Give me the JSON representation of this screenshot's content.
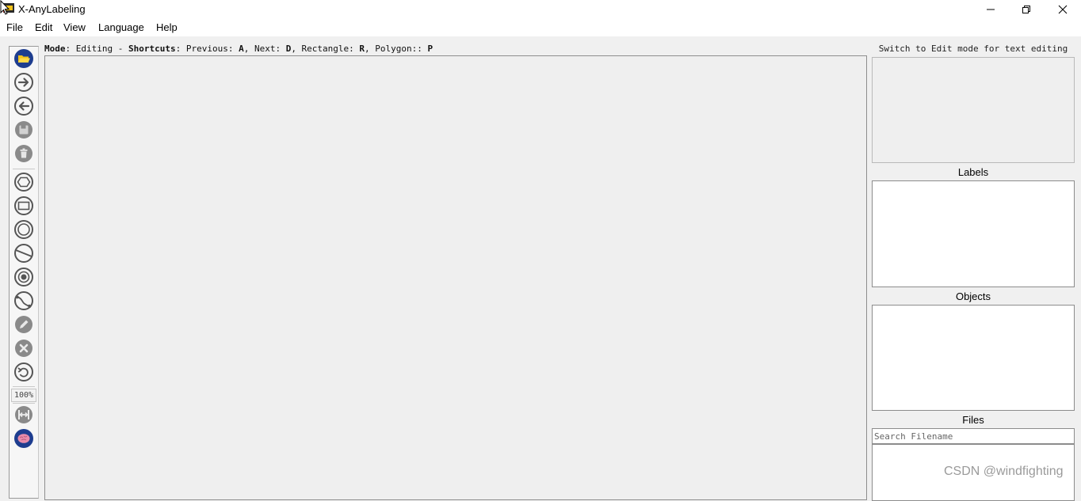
{
  "window": {
    "title": "X-AnyLabeling",
    "controls": [
      "minimize-icon",
      "restore-icon",
      "close-icon"
    ]
  },
  "menu": {
    "items": [
      "File",
      "Edit",
      "View",
      "Language",
      "Help"
    ]
  },
  "toolbar": {
    "icons": [
      "open-folder-icon",
      "next-image-icon",
      "previous-image-icon",
      "save-icon",
      "delete-icon",
      "polygon-icon",
      "rectangle-icon",
      "circle-icon",
      "line-icon",
      "point-icon",
      "linestrip-icon",
      "edit-pencil-icon",
      "close-shape-icon",
      "undo-icon",
      "fit-width-icon",
      "auto-labeling-brain-icon"
    ],
    "zoom": "100%"
  },
  "status": {
    "mode_label": "Mode",
    "mode_value": ": Editing - ",
    "shortcuts_label": "Shortcuts",
    "shortcuts_value": ": Previous: ",
    "prev_key": "A",
    "next_text": ", Next: ",
    "next_key": "D",
    "rect_text": ", Rectangle: ",
    "rect_key": "R",
    "poly_text": ", Polygon:: ",
    "poly_key": "P"
  },
  "right_panel": {
    "text_hint": "Switch to Edit mode for text editing",
    "labels_title": "Labels",
    "objects_title": "Objects",
    "files_title": "Files",
    "search_placeholder": "Search Filename"
  },
  "watermark": "CSDN @windfighting",
  "colors": {
    "accent_blue": "#1e3d8f",
    "folder_yellow": "#f2c21a",
    "brain_pink": "#e98cab",
    "icon_gray": "#6e6e6e"
  }
}
